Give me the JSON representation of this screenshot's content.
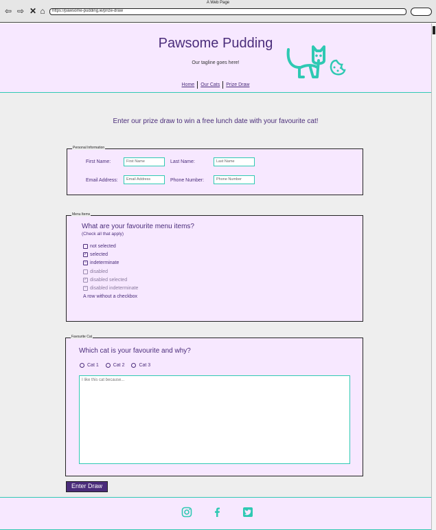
{
  "browser": {
    "window_title": "A Web Page",
    "url": "https://pawsome-pudding.ie/prize-draw"
  },
  "header": {
    "site_title": "Pawsome Pudding",
    "tagline": "Our tagline goes here!",
    "nav": [
      "Home",
      "Our Cats",
      "Prize Draw"
    ]
  },
  "main": {
    "intro": "Enter our prize draw to win a free lunch date with your favourite cat!",
    "personal": {
      "legend": "Personal Information",
      "first_name_label": "First Name:",
      "first_name_placeholder": "First Name",
      "last_name_label": "Last Name:",
      "last_name_placeholder": "Last Name",
      "email_label": "Email Address:",
      "email_placeholder": "Email Address",
      "phone_label": "Phone Number:",
      "phone_placeholder": "Phone Number"
    },
    "menu": {
      "legend": "Menu Items",
      "question": "What are your favourite menu items?",
      "hint": "(Check all that apply)",
      "options": [
        {
          "label": "not selected",
          "state": "unchecked",
          "disabled": false
        },
        {
          "label": "selected",
          "state": "checked",
          "disabled": false
        },
        {
          "label": "indeterminate",
          "state": "indeterminate",
          "disabled": false
        },
        {
          "label": "disabled",
          "state": "unchecked",
          "disabled": true
        },
        {
          "label": "disabled selected",
          "state": "checked",
          "disabled": true
        },
        {
          "label": "disabled indeterminate",
          "state": "indeterminate",
          "disabled": true
        }
      ],
      "plain_row": "A row without a checkbox"
    },
    "cat": {
      "legend": "Favourite Cat",
      "question": "Which cat is your favourite and why?",
      "options": [
        "Cat 1",
        "Cat 2",
        "Cat 3"
      ],
      "textarea_placeholder": "I like this cat because..."
    },
    "submit_label": "Enter Draw"
  },
  "footer": {
    "icons": [
      "instagram-icon",
      "facebook-icon",
      "twitter-icon"
    ]
  },
  "colors": {
    "accent": "#2fc9b3",
    "brand": "#4a2c7a",
    "panel": "#f7e8ff"
  }
}
